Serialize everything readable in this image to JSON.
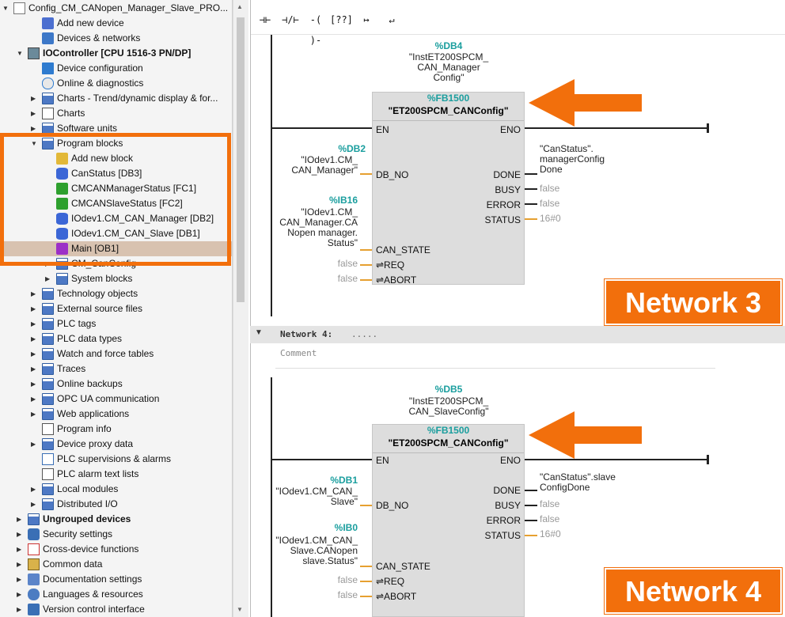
{
  "project_tree": {
    "items": [
      {
        "label": "Config_CM_CANopen_Manager_Slave_PRO...",
        "icon": "project-icon",
        "arrow": "down"
      },
      {
        "label": "Add new device",
        "icon": "add-device-icon",
        "arrow": ""
      },
      {
        "label": "Devices & networks",
        "icon": "network-icon",
        "arrow": ""
      },
      {
        "label": "IOController [CPU 1516-3 PN/DP]",
        "icon": "cpu-icon",
        "arrow": "down"
      },
      {
        "label": "Device configuration",
        "icon": "device-config-icon",
        "arrow": ""
      },
      {
        "label": "Online & diagnostics",
        "icon": "diagnostics-icon",
        "arrow": ""
      },
      {
        "label": "Charts - Trend/dynamic display & for...",
        "icon": "folder-icon",
        "arrow": "right"
      },
      {
        "label": "Charts",
        "icon": "chart-icon",
        "arrow": "right"
      },
      {
        "label": "Software units",
        "icon": "folder-icon",
        "arrow": "right"
      },
      {
        "label": "Program blocks",
        "icon": "folder-icon",
        "arrow": "down"
      },
      {
        "label": "Add new block",
        "icon": "add-block-icon",
        "arrow": ""
      },
      {
        "label": "CanStatus [DB3]",
        "icon": "db-icon",
        "arrow": ""
      },
      {
        "label": "CMCANManagerStatus [FC1]",
        "icon": "fc-icon",
        "arrow": ""
      },
      {
        "label": "CMCANSlaveStatus [FC2]",
        "icon": "fc-icon",
        "arrow": ""
      },
      {
        "label": "IOdev1.CM_CAN_Manager [DB2]",
        "icon": "db-icon",
        "arrow": ""
      },
      {
        "label": "IOdev1.CM_CAN_Slave [DB1]",
        "icon": "db-icon",
        "arrow": ""
      },
      {
        "label": "Main [OB1]",
        "icon": "ob-icon",
        "arrow": ""
      },
      {
        "label": "CM_CanConfig",
        "icon": "folder-icon",
        "arrow": "right"
      },
      {
        "label": "System blocks",
        "icon": "folder-icon",
        "arrow": "right"
      },
      {
        "label": "Technology objects",
        "icon": "folder-icon",
        "arrow": "right"
      },
      {
        "label": "External source files",
        "icon": "folder-icon",
        "arrow": "right"
      },
      {
        "label": "PLC tags",
        "icon": "folder-icon",
        "arrow": "right"
      },
      {
        "label": "PLC data types",
        "icon": "folder-icon",
        "arrow": "right"
      },
      {
        "label": "Watch and force tables",
        "icon": "folder-icon",
        "arrow": "right"
      },
      {
        "label": "Traces",
        "icon": "folder-icon",
        "arrow": "right"
      },
      {
        "label": "Online backups",
        "icon": "folder-icon",
        "arrow": "right"
      },
      {
        "label": "OPC UA communication",
        "icon": "folder-icon",
        "arrow": "right"
      },
      {
        "label": "Web applications",
        "icon": "folder-icon",
        "arrow": "right"
      },
      {
        "label": "Program info",
        "icon": "program-info-icon",
        "arrow": ""
      },
      {
        "label": "Device proxy data",
        "icon": "folder-icon",
        "arrow": "right"
      },
      {
        "label": "PLC supervisions & alarms",
        "icon": "alarms-icon",
        "arrow": ""
      },
      {
        "label": "PLC alarm text lists",
        "icon": "text-list-icon",
        "arrow": ""
      },
      {
        "label": "Local modules",
        "icon": "folder-icon",
        "arrow": "right"
      },
      {
        "label": "Distributed I/O",
        "icon": "folder-icon",
        "arrow": "right"
      },
      {
        "label": "Ungrouped devices",
        "icon": "folder-icon",
        "arrow": "right"
      },
      {
        "label": "Security settings",
        "icon": "security-icon",
        "arrow": "right"
      },
      {
        "label": "Cross-device functions",
        "icon": "cross-device-icon",
        "arrow": "right"
      },
      {
        "label": "Common data",
        "icon": "common-data-icon",
        "arrow": "right"
      },
      {
        "label": "Documentation settings",
        "icon": "docs-icon",
        "arrow": "right"
      },
      {
        "label": "Languages & resources",
        "icon": "languages-icon",
        "arrow": "right"
      },
      {
        "label": "Version control interface",
        "icon": "version-control-icon",
        "arrow": "right"
      }
    ]
  },
  "toolbar": {
    "buttons": [
      {
        "label": "⊣⊢",
        "name": "no-contact-button"
      },
      {
        "label": "⊣/⊢",
        "name": "nc-contact-button"
      },
      {
        "label": "-( )-",
        "name": "coil-button"
      },
      {
        "label": "[??]",
        "name": "empty-box-button"
      },
      {
        "label": "↦",
        "name": "open-branch-button"
      },
      {
        "label": "↵",
        "name": "close-branch-button"
      }
    ]
  },
  "network3": {
    "instance_db_num": "%DB4",
    "instance_db_name": "\"InstET200SPCM_\nCAN_Manager\nConfig\"",
    "fb_num": "%FB1500",
    "fb_name": "\"ET200SPCM_CANConfig\"",
    "en": "EN",
    "eno": "ENO",
    "db_no_addr": "%DB2",
    "db_no_name": "\"IOdev1.CM_\nCAN_Manager\"",
    "db_no_pin": "DB_NO",
    "can_state_addr": "%IB16",
    "can_state_name": "\"IOdev1.CM_\nCAN_Manager.CA\nNopen manager.\nStatus\"",
    "can_state_pin": "CAN_STATE",
    "req_val": "false",
    "req_pin": "⇌REQ",
    "abort_val": "false",
    "abort_pin": "⇌ABORT",
    "done_pin": "DONE",
    "busy_pin": "BUSY",
    "error_pin": "ERROR",
    "status_pin": "STATUS",
    "done_val": "\"CanStatus\".\nmanagerConfig\nDone",
    "busy_val": "false",
    "error_val": "false",
    "status_val": "16#0",
    "badge": "Network 3"
  },
  "network4": {
    "header": "Network 4:",
    "title_placeholder": ".....",
    "comment_placeholder": "Comment",
    "instance_db_num": "%DB5",
    "instance_db_name": "\"InstET200SPCM_\nCAN_SlaveConfig\"",
    "fb_num": "%FB1500",
    "fb_name": "\"ET200SPCM_CANConfig\"",
    "en": "EN",
    "eno": "ENO",
    "db_no_addr": "%DB1",
    "db_no_name": "\"IOdev1.CM_CAN_\nSlave\"",
    "db_no_pin": "DB_NO",
    "can_state_addr": "%IB0",
    "can_state_name": "\"IOdev1.CM_CAN_\nSlave.CANopen\nslave.Status\"",
    "can_state_pin": "CAN_STATE",
    "req_val": "false",
    "req_pin": "⇌REQ",
    "abort_val": "false",
    "abort_pin": "⇌ABORT",
    "done_pin": "DONE",
    "busy_pin": "BUSY",
    "error_pin": "ERROR",
    "status_pin": "STATUS",
    "done_val": "\"CanStatus\".slave\nConfigDone",
    "busy_val": "false",
    "error_val": "false",
    "status_val": "16#0",
    "badge": "Network 4"
  },
  "colors": {
    "accent": "#f26f0c",
    "teal": "#1a9e9e",
    "selection": "#d8c2b0"
  }
}
